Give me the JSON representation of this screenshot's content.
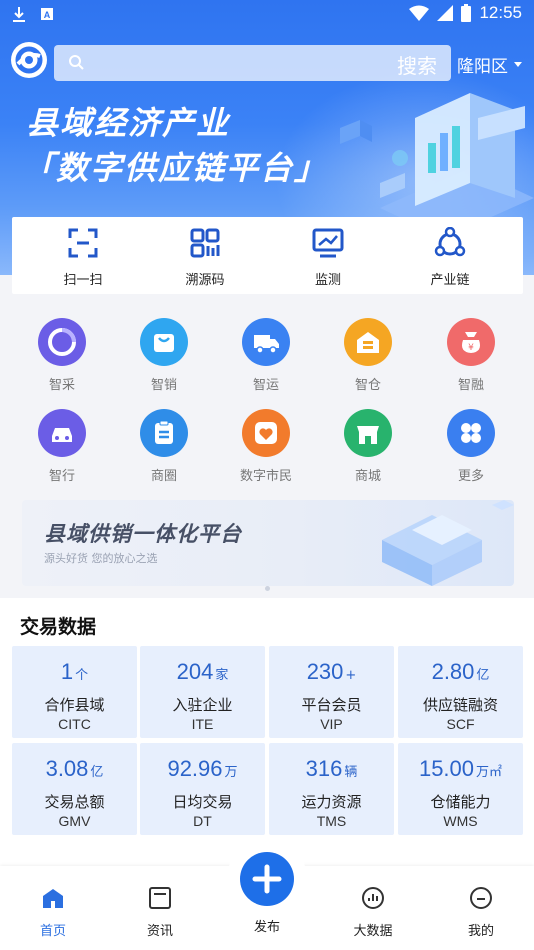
{
  "status_bar": {
    "time": "12:55"
  },
  "header": {
    "search_button": "搜索",
    "search_placeholder": "",
    "region": "隆阳区"
  },
  "banner": {
    "line1": "县域经济产业",
    "line2": "「数字供应链平台」"
  },
  "tools": [
    {
      "label": "扫一扫",
      "icon": "scan-icon"
    },
    {
      "label": "溯源码",
      "icon": "qr-code-icon"
    },
    {
      "label": "监测",
      "icon": "monitor-icon"
    },
    {
      "label": "产业链",
      "icon": "network-icon"
    }
  ],
  "grid": [
    {
      "label": "智采",
      "icon": "procure-icon",
      "color": "#6b5de6"
    },
    {
      "label": "智销",
      "icon": "shopping-bag-icon",
      "color": "#2fa6f0"
    },
    {
      "label": "智运",
      "icon": "truck-icon",
      "color": "#3a82f2"
    },
    {
      "label": "智仓",
      "icon": "warehouse-icon",
      "color": "#f5a623"
    },
    {
      "label": "智融",
      "icon": "money-bag-icon",
      "color": "#f06a6a"
    },
    {
      "label": "智行",
      "icon": "car-icon",
      "color": "#6b5de6"
    },
    {
      "label": "商圈",
      "icon": "clipboard-icon",
      "color": "#2f8de8"
    },
    {
      "label": "数字市民",
      "icon": "heart-icon",
      "color": "#f27b2c"
    },
    {
      "label": "商城",
      "icon": "store-icon",
      "color": "#28b36d"
    },
    {
      "label": "更多",
      "icon": "more-grid-icon",
      "color": "#3a7ff0"
    }
  ],
  "promo": {
    "title": "县域供销一体化平台",
    "subtitle": "源头好货 您的放心之选"
  },
  "trade": {
    "title": "交易数据",
    "cards": [
      {
        "value": "1",
        "unit": "个",
        "name": "合作县域",
        "code": "CITC"
      },
      {
        "value": "204",
        "unit": "家",
        "name": "入驻企业",
        "code": "ITE"
      },
      {
        "value": "230",
        "unit": "+",
        "name": "平台会员",
        "code": "VIP"
      },
      {
        "value": "2.80",
        "unit": "亿",
        "name": "供应链融资",
        "code": "SCF"
      },
      {
        "value": "3.08",
        "unit": "亿",
        "name": "交易总额",
        "code": "GMV"
      },
      {
        "value": "92.96",
        "unit": "万",
        "name": "日均交易",
        "code": "DT"
      },
      {
        "value": "316",
        "unit": "辆",
        "name": "运力资源",
        "code": "TMS"
      },
      {
        "value": "15.00",
        "unit": "万㎡",
        "name": "仓储能力",
        "code": "WMS"
      }
    ]
  },
  "nav": {
    "home": "首页",
    "news": "资讯",
    "publish": "发布",
    "bigdata": "大数据",
    "mine": "我的"
  },
  "colors": {
    "brand": "#2f74f0",
    "card_bg": "#e7effd",
    "value_text": "#2b63c9"
  }
}
